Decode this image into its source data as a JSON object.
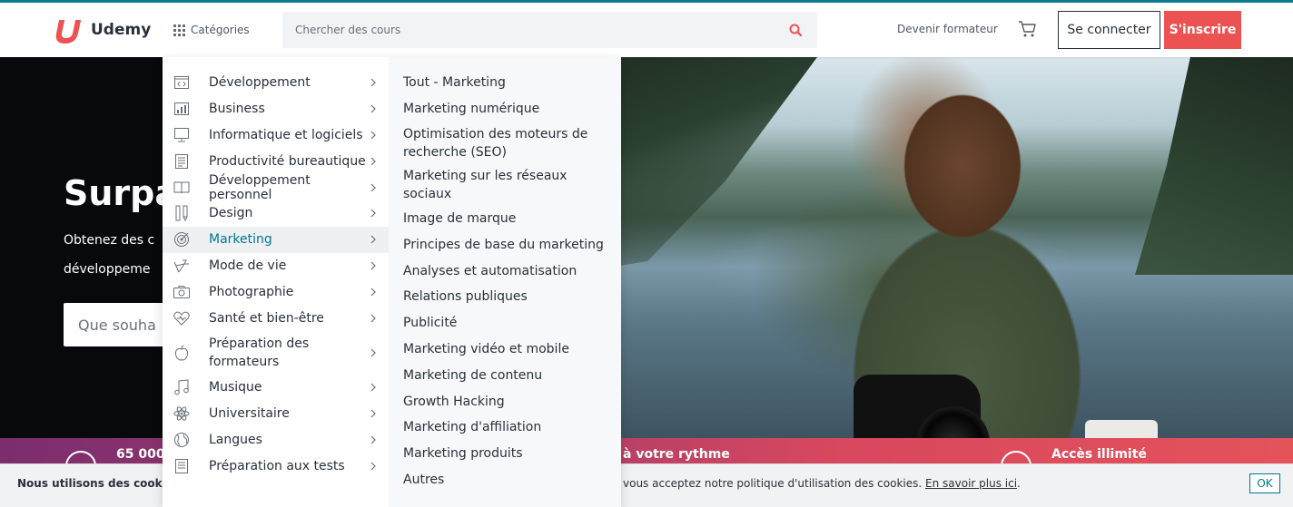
{
  "header": {
    "logo_text": "Udemy",
    "categories_label": "Catégories",
    "search_placeholder": "Chercher des cours",
    "teach_label": "Devenir formateur",
    "login_label": "Se connecter",
    "signup_label": "S'inscrire",
    "accent_color": "#ec5252"
  },
  "hero": {
    "title": "Surpa",
    "subtitle_line1": "Obtenez des c",
    "subtitle_line2": "développeme",
    "search_placeholder": "Que souha"
  },
  "menu": {
    "categories": [
      {
        "label": "Développement",
        "icon": "code-icon"
      },
      {
        "label": "Business",
        "icon": "chart-icon"
      },
      {
        "label": "Informatique et logiciels",
        "icon": "monitor-icon"
      },
      {
        "label": "Productivité bureautique",
        "icon": "document-icon"
      },
      {
        "label": "Développement personnel",
        "icon": "book-icon"
      },
      {
        "label": "Design",
        "icon": "pencil-icon"
      },
      {
        "label": "Marketing",
        "icon": "target-icon",
        "active": true
      },
      {
        "label": "Mode de vie",
        "icon": "lifestyle-icon"
      },
      {
        "label": "Photographie",
        "icon": "camera-icon"
      },
      {
        "label": "Santé et bien-être",
        "icon": "heart-icon"
      },
      {
        "label": "Préparation des formateurs",
        "icon": "apple-icon"
      },
      {
        "label": "Musique",
        "icon": "music-icon"
      },
      {
        "label": "Universitaire",
        "icon": "atom-icon"
      },
      {
        "label": "Langues",
        "icon": "globe-icon"
      },
      {
        "label": "Préparation aux tests",
        "icon": "test-icon"
      }
    ],
    "subcategories": [
      "Tout - Marketing",
      "Marketing numérique",
      "Optimisation des moteurs de recherche (SEO)",
      "Marketing sur les réseaux sociaux",
      "Image de marque",
      "Principes de base du marketing",
      "Analyses et automatisation",
      "Relations publiques",
      "Publicité",
      "Marketing vidéo et mobile",
      "Marketing de contenu",
      "Growth Hacking",
      "Marketing d'affiliation",
      "Marketing produits",
      "Autres"
    ],
    "active_color": "#007791"
  },
  "band": {
    "left_text": "65 000",
    "mid_text": "à votre rythme",
    "right_text": "Accès illimité"
  },
  "cookie": {
    "left_text": "Nous utilisons des cooki",
    "right_text": "vous acceptez notre politique d'utilisation des cookies.",
    "link_text": "En savoir plus ici",
    "link_suffix": ".",
    "ok_label": "OK"
  }
}
